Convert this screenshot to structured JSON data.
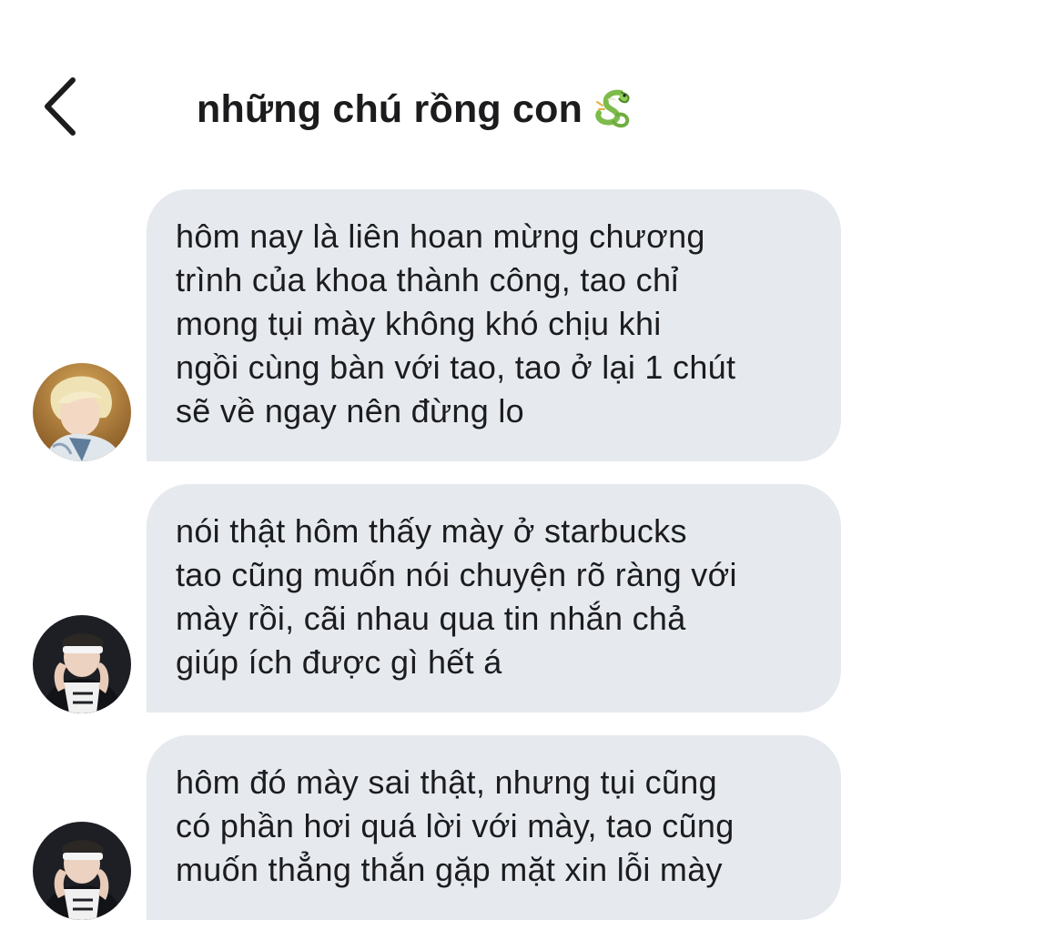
{
  "header": {
    "title": "những chú rồng con",
    "title_icon": "dragon-icon",
    "back_icon": "chevron-left-icon"
  },
  "messages": [
    {
      "avatar": "avatar-blonde",
      "text": "hôm nay là liên hoan mừng chương\ntrình của khoa thành công, tao chỉ\nmong tụi mày không khó chịu khi\nngồi cùng bàn với tao, tao ở lại 1 chút\nsẽ về ngay nên đừng lo"
    },
    {
      "avatar": "avatar-dark",
      "text": "nói thật hôm thấy mày ở starbucks\ntao cũng muốn nói chuyện rõ ràng với\nmày rồi, cãi nhau qua tin nhắn chả\ngiúp ích được gì hết á"
    },
    {
      "avatar": "avatar-dark",
      "text": "hôm đó mày sai thật, nhưng tụi cũng\ncó phần hơi quá lời với mày, tao cũng\nmuốn thẳng thắn gặp mặt xin lỗi mày"
    }
  ],
  "colors": {
    "bubble": "#e6eaef",
    "text": "#1c1c1e",
    "background": "#ffffff"
  }
}
